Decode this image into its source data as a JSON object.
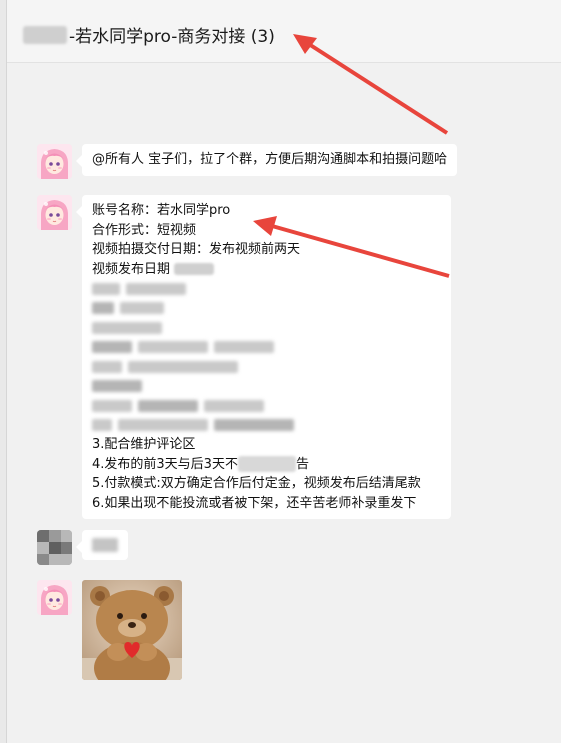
{
  "chat": {
    "title": "-若水同学pro-商务对接 (3)"
  },
  "messages": {
    "m1": "@所有人 宝子们，拉了个群，方便后期沟通脚本和拍摄问题哈",
    "m2": {
      "line1": "账号名称：若水同学pro",
      "line2": "合作形式：短视频",
      "line3": "视频拍摄交付日期：发布视频前两天",
      "line4": "视频发布日期",
      "line5": "3.配合维护评论区",
      "line6": "4.发布的前3天与后3天不",
      "line6b": "告",
      "line7": "5.付款模式:双方确定合作后付定金，视频发布后结清尾款",
      "line8": "6.如果出现不能投流或者被下架，还辛苦老师补录重发下"
    }
  },
  "colors": {
    "arrow": "#e8453c",
    "bubble": "#ffffff",
    "background": "#f1f1f1"
  },
  "icons": {
    "avatar": "anime-girl-avatar",
    "sticker": "teddy-bear-heart-sticker"
  }
}
